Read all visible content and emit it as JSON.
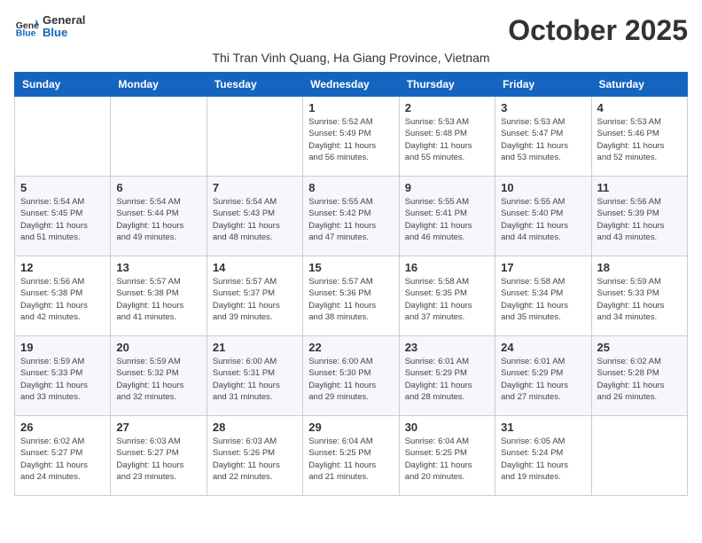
{
  "header": {
    "logo_general": "General",
    "logo_blue": "Blue",
    "month_title": "October 2025",
    "subtitle": "Thi Tran Vinh Quang, Ha Giang Province, Vietnam"
  },
  "columns": [
    "Sunday",
    "Monday",
    "Tuesday",
    "Wednesday",
    "Thursday",
    "Friday",
    "Saturday"
  ],
  "weeks": [
    [
      {
        "day": "",
        "info": ""
      },
      {
        "day": "",
        "info": ""
      },
      {
        "day": "",
        "info": ""
      },
      {
        "day": "1",
        "info": "Sunrise: 5:52 AM\nSunset: 5:49 PM\nDaylight: 11 hours\nand 56 minutes."
      },
      {
        "day": "2",
        "info": "Sunrise: 5:53 AM\nSunset: 5:48 PM\nDaylight: 11 hours\nand 55 minutes."
      },
      {
        "day": "3",
        "info": "Sunrise: 5:53 AM\nSunset: 5:47 PM\nDaylight: 11 hours\nand 53 minutes."
      },
      {
        "day": "4",
        "info": "Sunrise: 5:53 AM\nSunset: 5:46 PM\nDaylight: 11 hours\nand 52 minutes."
      }
    ],
    [
      {
        "day": "5",
        "info": "Sunrise: 5:54 AM\nSunset: 5:45 PM\nDaylight: 11 hours\nand 51 minutes."
      },
      {
        "day": "6",
        "info": "Sunrise: 5:54 AM\nSunset: 5:44 PM\nDaylight: 11 hours\nand 49 minutes."
      },
      {
        "day": "7",
        "info": "Sunrise: 5:54 AM\nSunset: 5:43 PM\nDaylight: 11 hours\nand 48 minutes."
      },
      {
        "day": "8",
        "info": "Sunrise: 5:55 AM\nSunset: 5:42 PM\nDaylight: 11 hours\nand 47 minutes."
      },
      {
        "day": "9",
        "info": "Sunrise: 5:55 AM\nSunset: 5:41 PM\nDaylight: 11 hours\nand 46 minutes."
      },
      {
        "day": "10",
        "info": "Sunrise: 5:55 AM\nSunset: 5:40 PM\nDaylight: 11 hours\nand 44 minutes."
      },
      {
        "day": "11",
        "info": "Sunrise: 5:56 AM\nSunset: 5:39 PM\nDaylight: 11 hours\nand 43 minutes."
      }
    ],
    [
      {
        "day": "12",
        "info": "Sunrise: 5:56 AM\nSunset: 5:38 PM\nDaylight: 11 hours\nand 42 minutes."
      },
      {
        "day": "13",
        "info": "Sunrise: 5:57 AM\nSunset: 5:38 PM\nDaylight: 11 hours\nand 41 minutes."
      },
      {
        "day": "14",
        "info": "Sunrise: 5:57 AM\nSunset: 5:37 PM\nDaylight: 11 hours\nand 39 minutes."
      },
      {
        "day": "15",
        "info": "Sunrise: 5:57 AM\nSunset: 5:36 PM\nDaylight: 11 hours\nand 38 minutes."
      },
      {
        "day": "16",
        "info": "Sunrise: 5:58 AM\nSunset: 5:35 PM\nDaylight: 11 hours\nand 37 minutes."
      },
      {
        "day": "17",
        "info": "Sunrise: 5:58 AM\nSunset: 5:34 PM\nDaylight: 11 hours\nand 35 minutes."
      },
      {
        "day": "18",
        "info": "Sunrise: 5:59 AM\nSunset: 5:33 PM\nDaylight: 11 hours\nand 34 minutes."
      }
    ],
    [
      {
        "day": "19",
        "info": "Sunrise: 5:59 AM\nSunset: 5:33 PM\nDaylight: 11 hours\nand 33 minutes."
      },
      {
        "day": "20",
        "info": "Sunrise: 5:59 AM\nSunset: 5:32 PM\nDaylight: 11 hours\nand 32 minutes."
      },
      {
        "day": "21",
        "info": "Sunrise: 6:00 AM\nSunset: 5:31 PM\nDaylight: 11 hours\nand 31 minutes."
      },
      {
        "day": "22",
        "info": "Sunrise: 6:00 AM\nSunset: 5:30 PM\nDaylight: 11 hours\nand 29 minutes."
      },
      {
        "day": "23",
        "info": "Sunrise: 6:01 AM\nSunset: 5:29 PM\nDaylight: 11 hours\nand 28 minutes."
      },
      {
        "day": "24",
        "info": "Sunrise: 6:01 AM\nSunset: 5:29 PM\nDaylight: 11 hours\nand 27 minutes."
      },
      {
        "day": "25",
        "info": "Sunrise: 6:02 AM\nSunset: 5:28 PM\nDaylight: 11 hours\nand 26 minutes."
      }
    ],
    [
      {
        "day": "26",
        "info": "Sunrise: 6:02 AM\nSunset: 5:27 PM\nDaylight: 11 hours\nand 24 minutes."
      },
      {
        "day": "27",
        "info": "Sunrise: 6:03 AM\nSunset: 5:27 PM\nDaylight: 11 hours\nand 23 minutes."
      },
      {
        "day": "28",
        "info": "Sunrise: 6:03 AM\nSunset: 5:26 PM\nDaylight: 11 hours\nand 22 minutes."
      },
      {
        "day": "29",
        "info": "Sunrise: 6:04 AM\nSunset: 5:25 PM\nDaylight: 11 hours\nand 21 minutes."
      },
      {
        "day": "30",
        "info": "Sunrise: 6:04 AM\nSunset: 5:25 PM\nDaylight: 11 hours\nand 20 minutes."
      },
      {
        "day": "31",
        "info": "Sunrise: 6:05 AM\nSunset: 5:24 PM\nDaylight: 11 hours\nand 19 minutes."
      },
      {
        "day": "",
        "info": ""
      }
    ]
  ]
}
